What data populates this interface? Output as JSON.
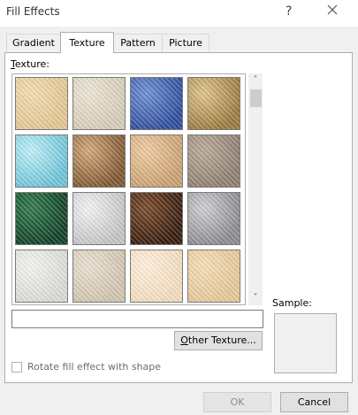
{
  "window": {
    "title": "Fill Effects",
    "help_glyph": "?",
    "close_icon": "close-icon"
  },
  "tabs": [
    {
      "label": "Gradient",
      "active": false
    },
    {
      "label": "Texture",
      "active": true
    },
    {
      "label": "Pattern",
      "active": false
    },
    {
      "label": "Picture",
      "active": false
    }
  ],
  "texture_section": {
    "label_accel": "T",
    "label_rest": "exture:",
    "tiles": [
      {
        "name": "papyrus",
        "c1": "#f2ddb0",
        "c2": "#e3c690"
      },
      {
        "name": "canvas",
        "c1": "#eee6d6",
        "c2": "#d6ccb6"
      },
      {
        "name": "denim",
        "c1": "#6e8ed4",
        "c2": "#2e4c9c"
      },
      {
        "name": "woven-mat",
        "c1": "#e0c488",
        "c2": "#9a7a3e"
      },
      {
        "name": "water-droplets",
        "c1": "#bff0f8",
        "c2": "#6cc4d8"
      },
      {
        "name": "paper-bag",
        "c1": "#d2a878",
        "c2": "#7e5630"
      },
      {
        "name": "fish-fossil",
        "c1": "#efcba0",
        "c2": "#caa070"
      },
      {
        "name": "sand",
        "c1": "#b9aa98",
        "c2": "#8e7e70"
      },
      {
        "name": "green-marble",
        "c1": "#2f7a4c",
        "c2": "#0e3e24"
      },
      {
        "name": "white-marble",
        "c1": "#f4f4f4",
        "c2": "#c4c4c4"
      },
      {
        "name": "brown-marble",
        "c1": "#7a4a2a",
        "c2": "#341a0c"
      },
      {
        "name": "granite",
        "c1": "#cfcfd2",
        "c2": "#8a8a90"
      },
      {
        "name": "newsprint",
        "c1": "#f4f4f2",
        "c2": "#dadad6"
      },
      {
        "name": "recycled-paper",
        "c1": "#e8e0d0",
        "c2": "#d0c4ae"
      },
      {
        "name": "parchment",
        "c1": "#fff0dc",
        "c2": "#f4dcbc"
      },
      {
        "name": "stationery",
        "c1": "#f4ddb6",
        "c2": "#e6c798"
      }
    ],
    "scroll_up": "˄",
    "scroll_down": "˅"
  },
  "texture_name_value": "",
  "other_texture": {
    "accel": "O",
    "rest": "ther Texture..."
  },
  "rotate_checkbox": {
    "label": "Rotate fill effect with shape",
    "checked": false,
    "enabled": false
  },
  "sample": {
    "label": "Sample:"
  },
  "buttons": {
    "ok": "OK",
    "cancel": "Cancel"
  }
}
